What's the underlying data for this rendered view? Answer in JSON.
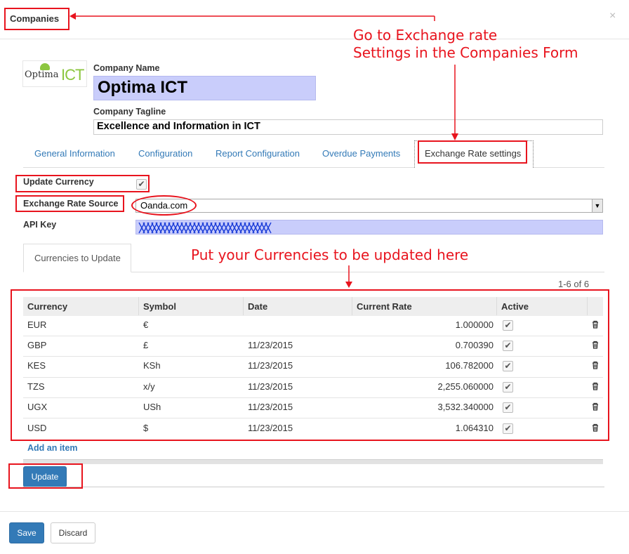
{
  "modal": {
    "title": "Companies",
    "close": "×"
  },
  "logo": {
    "part1": "Optima",
    "part2": "ICT"
  },
  "form": {
    "company_name_label": "Company Name",
    "company_name": "Optima ICT",
    "tagline_label": "Company Tagline",
    "tagline": "Excellence and Information in ICT"
  },
  "tabs": [
    {
      "label": "General Information"
    },
    {
      "label": "Configuration"
    },
    {
      "label": "Report Configuration"
    },
    {
      "label": "Overdue Payments"
    },
    {
      "label": "Exchange Rate settings",
      "active": true
    }
  ],
  "exchange": {
    "update_currency_label": "Update Currency",
    "update_currency_checked": true,
    "source_label": "Exchange Rate Source",
    "source_value": "Oanda.com",
    "api_key_label": "API Key"
  },
  "currencies_tab": "Currencies to Update",
  "pager": "1-6 of 6",
  "table": {
    "columns": [
      "Currency",
      "Symbol",
      "Date",
      "Current Rate",
      "Active"
    ],
    "rows": [
      {
        "currency": "EUR",
        "symbol": "€",
        "date": "",
        "rate": "1.000000",
        "active": true
      },
      {
        "currency": "GBP",
        "symbol": "£",
        "date": "11/23/2015",
        "rate": "0.700390",
        "active": true
      },
      {
        "currency": "KES",
        "symbol": "KSh",
        "date": "11/23/2015",
        "rate": "106.782000",
        "active": true
      },
      {
        "currency": "TZS",
        "symbol": "x/y",
        "date": "11/23/2015",
        "rate": "2,255.060000",
        "active": true
      },
      {
        "currency": "UGX",
        "symbol": "USh",
        "date": "11/23/2015",
        "rate": "3,532.340000",
        "active": true
      },
      {
        "currency": "USD",
        "symbol": "$",
        "date": "11/23/2015",
        "rate": "1.064310",
        "active": true
      }
    ]
  },
  "add_item": "Add an item",
  "buttons": {
    "update": "Update",
    "save": "Save",
    "discard": "Discard"
  },
  "annotations": {
    "exchange_line1": "Go to Exchange rate",
    "exchange_line2": "Settings in the Companies Form",
    "currencies": "Put your Currencies to be updated here"
  },
  "colors": {
    "annotation": "#e8141e",
    "primary": "#337ab7",
    "field_highlight": "#c9cdfb",
    "logo_green": "#8cc63f"
  }
}
